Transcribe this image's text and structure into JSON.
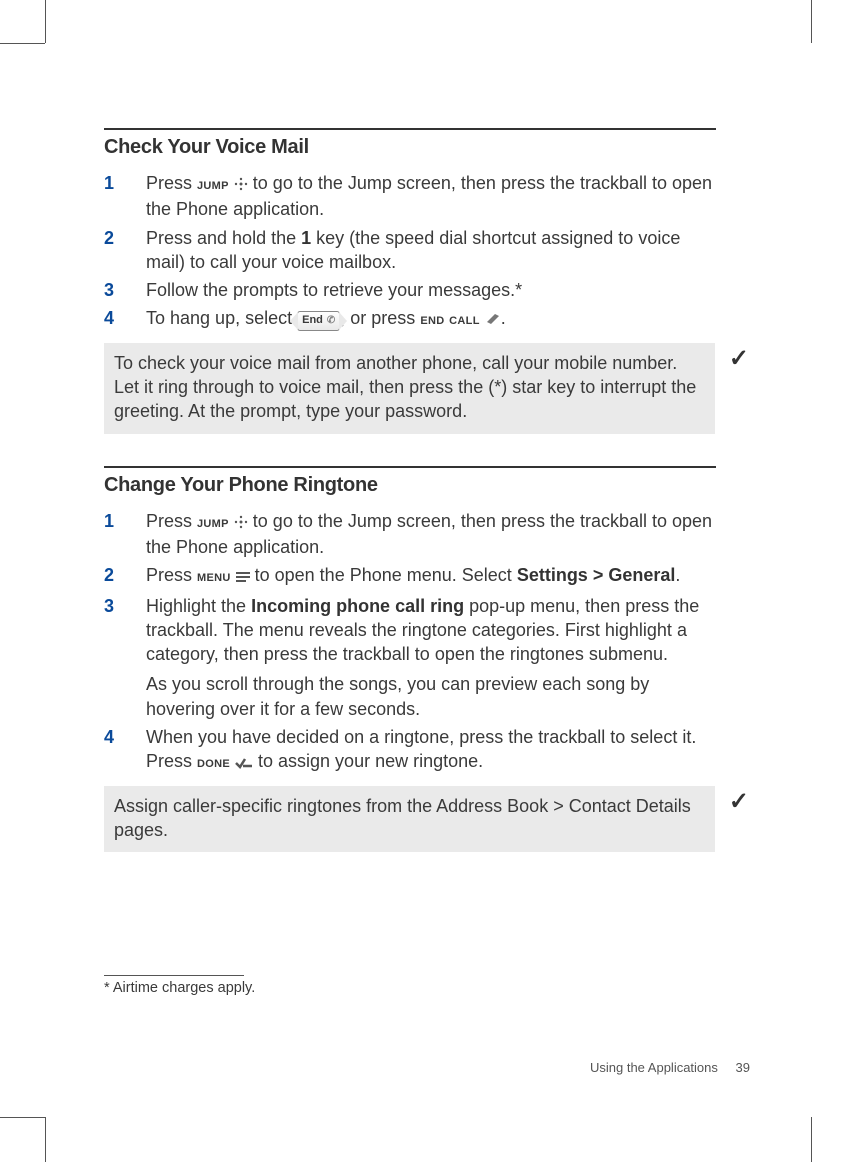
{
  "section1": {
    "heading": "Check Your Voice Mail",
    "steps": [
      {
        "n": "1",
        "pre": "Press ",
        "key": "jump",
        "post": " to go to the Jump screen, then press the trackball to open the Phone application."
      },
      {
        "n": "2",
        "pre": "Press and hold the ",
        "bold": "1",
        "post": " key (the speed dial shortcut assigned to voice mail) to call your voice mailbox."
      },
      {
        "n": "3",
        "text": "Follow the prompts to retrieve your messages.*"
      },
      {
        "n": "4",
        "pre": "To hang up, select ",
        "endbtn": "End",
        "mid": ", or press ",
        "key2": "end call",
        "post": "."
      }
    ],
    "tip": "To check your voice mail from another phone, call your mobile number. Let it ring through to voice mail, then press the (*) star key to interrupt the greeting. At the prompt, type your password."
  },
  "section2": {
    "heading": "Change Your Phone Ringtone",
    "steps": [
      {
        "n": "1",
        "pre": "Press ",
        "key": "jump",
        "post": " to go to the Jump screen, then press the trackball to open the Phone application."
      },
      {
        "n": "2",
        "pre": "Press ",
        "key": "menu",
        "mid": " to open the Phone menu. Select ",
        "bold": "Settings > General",
        "post": "."
      },
      {
        "n": "3",
        "pre": "Highlight the ",
        "bold": "Incoming phone call ring",
        "post": " pop-up menu, then press the trackball. The menu reveals the ringtone categories. First highlight a category, then press the trackball to open the ringtones submenu.",
        "extra": "As you scroll through the songs, you can preview each song by hovering over it for a few seconds."
      },
      {
        "n": "4",
        "pre": "When you have decided on a ringtone, press the trackball to select it. Press ",
        "key": "done",
        "post": " to assign your new ringtone."
      }
    ],
    "tip": "Assign caller-specific ringtones from the Address Book > Contact Details pages."
  },
  "footnote": "* Airtime charges apply.",
  "footer_label": "Using the Applications",
  "footer_page": "39",
  "icons": {
    "jump": "jump-icon",
    "menu": "menu-icon",
    "endcall": "end-call-icon",
    "done": "done-icon",
    "check": "✓"
  }
}
